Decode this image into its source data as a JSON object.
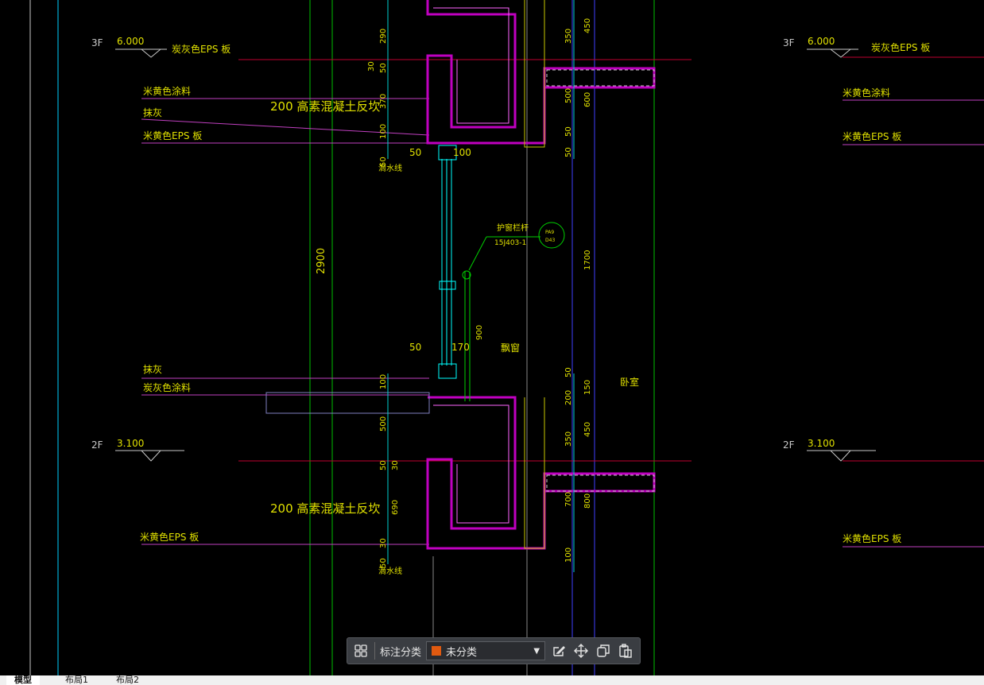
{
  "drawing": {
    "left_levels": [
      {
        "floor": "3F",
        "elevation": "6.000"
      },
      {
        "floor": "2F",
        "elevation": "3.100"
      }
    ],
    "right_levels": [
      {
        "floor": "3F",
        "elevation": "6.000"
      },
      {
        "floor": "2F",
        "elevation": "3.100"
      }
    ],
    "left_labels": [
      "炭灰色EPS 板",
      "米黄色涂料",
      "抹灰",
      "米黄色EPS 板",
      "抹灰",
      "炭灰色涂料",
      "米黄色EPS 板"
    ],
    "right_labels": [
      "炭灰色EPS 板",
      "米黄色涂料",
      "米黄色EPS 板",
      "米黄色EPS 板"
    ],
    "curb_labels": [
      "200  高素混凝土反坎",
      "200  高素混凝土反坎"
    ],
    "drip_labels": [
      "滴水线",
      "滴水线"
    ],
    "railing_label": "护窗栏杆",
    "railing_ref": "15J403-1",
    "railing_bubble_top": "PA9",
    "railing_bubble_bottom": "D43",
    "bay_window": "飘窗",
    "bedroom": "卧室",
    "total_height": "2900",
    "dims_left": [
      "290",
      "30",
      "50",
      "370",
      "100",
      "50",
      "100",
      "500",
      "50",
      "30",
      "690",
      "30",
      "50"
    ],
    "dims_right": [
      "350",
      "450",
      "500",
      "600",
      "50",
      "50",
      "1700",
      "50",
      "200",
      "150",
      "350",
      "450",
      "700",
      "800",
      "100"
    ],
    "dims_misc": [
      "50",
      "100",
      "50",
      "170",
      "900"
    ]
  },
  "toolbar": {
    "grid_icon": "grid-icon",
    "category_label": "标注分类",
    "category_value": "未分类",
    "category_color": "#e05a10"
  },
  "tabs": [
    "模型",
    "布局1",
    "布局2"
  ]
}
